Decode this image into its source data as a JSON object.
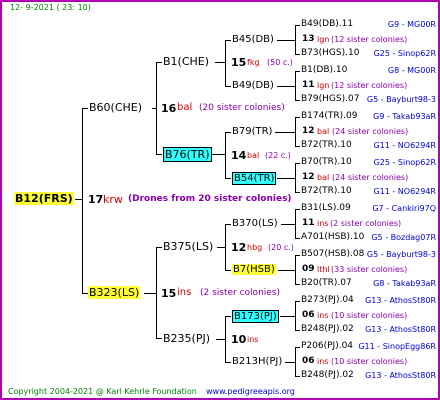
{
  "header": {
    "date": "12-  9-2021 ( 23: 10)"
  },
  "footer": {
    "copyright": "Copyright 2004-2021 @ Karl Kehrle Foundation",
    "website": "www.pedigreeapis.org"
  },
  "root": {
    "name": "B12(FRS)",
    "drones_num": "17",
    "drones_code": "krw",
    "drones_note": "(Drones from 20 sister colonies)"
  },
  "gen1": [
    {
      "name": "B60(CHE)",
      "num": "16",
      "code": "bal",
      "note": "(20 sister colonies)"
    },
    {
      "name": "B323(LS)",
      "num": "15",
      "code": "ins",
      "note": "(2 sister colonies)"
    }
  ],
  "gen2": [
    {
      "name": "B1(CHE)",
      "num": "15",
      "code": "fkg",
      "note": "(50 c.)"
    },
    {
      "name": "B76(TR)",
      "num": "14",
      "code": "bal",
      "note": "(22 c.)"
    },
    {
      "name": "B375(LS)",
      "num": "12",
      "code": "hbg",
      "note": "(20 c.)"
    },
    {
      "name": "B235(PJ)",
      "num": "10",
      "code": "ins",
      "note": ""
    }
  ],
  "gen3": [
    {
      "name": "B45(DB)",
      "num": "13",
      "code": "lgn",
      "note": "(12 sister colonies)"
    },
    {
      "name": "B49(DB)",
      "num": "11",
      "code": "lgn",
      "note": "(12 sister colonies)"
    },
    {
      "name": "B79(TR)",
      "num": "12",
      "code": "bal",
      "note": "(24 sister colonies)"
    },
    {
      "name": "B54(TR)",
      "num": "12",
      "code": "bal",
      "note": "(24 sister colonies)"
    },
    {
      "name": "B370(LS)",
      "num": "11",
      "code": "ins",
      "note": "(2 sister colonies)"
    },
    {
      "name": "B7(HSB)",
      "num": "09",
      "code": "lthl",
      "note": "(33 sister colonies)"
    },
    {
      "name": "B173(PJ)",
      "num": "06",
      "code": "ins",
      "note": "(10 sister colonies)"
    },
    {
      "name": "B213H(PJ)",
      "num": "06",
      "code": "ins",
      "note": "(10 sister colonies)"
    }
  ],
  "gen4": [
    {
      "left": "B49(DB).11",
      "right": "G9 - MG00R"
    },
    {
      "left": "B73(HGS).10",
      "right": "G25 - Sinop62R"
    },
    {
      "left": "B1(DB).10",
      "right": "G8 - MG00R"
    },
    {
      "left": "B79(HGS).07",
      "right": "G5 - Bayburt98-3"
    },
    {
      "left": "B174(TR).09",
      "right": "G9 - Takab93aR"
    },
    {
      "left": "B72(TR).10",
      "right": "G11 - NO6294R"
    },
    {
      "left": "B70(TR).10",
      "right": "G25 - Sinop62R"
    },
    {
      "left": "B72(TR).10",
      "right": "G11 - NO6294R"
    },
    {
      "left": "B31(LS).09",
      "right": "G7 - Cankiri97Q"
    },
    {
      "left": "A701(HSB).10",
      "right": "G5 - Bozdag07R"
    },
    {
      "left": "B507(HSB).08",
      "right": "G5 - Bayburt98-3"
    },
    {
      "left": "B20(TR).07",
      "right": "G8 - Takab93aR"
    },
    {
      "left": "B273(PJ).04",
      "right": "G13 - AthosSt80R"
    },
    {
      "left": "B248(PJ).02",
      "right": "G13 - AthosSt80R"
    },
    {
      "left": "P206(PJ).04",
      "right": "G11 - SinopEgg86R"
    },
    {
      "left": "B248(PJ).02",
      "right": "G13 - AthosSt80R"
    }
  ]
}
